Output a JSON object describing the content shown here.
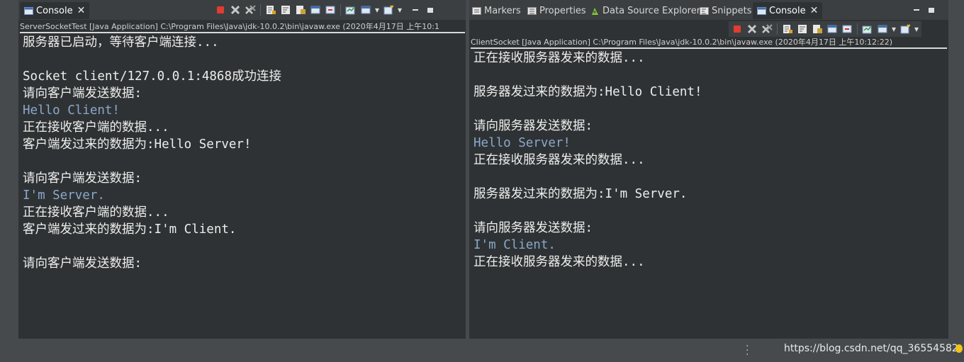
{
  "left_view": {
    "tab": {
      "label": "Console",
      "icon": "console-icon",
      "close": "✕"
    },
    "process_label": "ServerSocketTest [Java Application] C:\\Program Files\\Java\\jdk-10.0.2\\bin\\javaw.exe (2020年4月17日 上午10:1",
    "lines": [
      {
        "text": "服务器已启动，等待客户端连接...",
        "kind": "out"
      },
      {
        "text": "",
        "kind": "out"
      },
      {
        "text": "Socket client/127.0.0.1:4868成功连接",
        "kind": "out"
      },
      {
        "text": "请向客户端发送数据:",
        "kind": "out"
      },
      {
        "text": "Hello Client!",
        "kind": "input"
      },
      {
        "text": "正在接收客户端的数据...",
        "kind": "out"
      },
      {
        "text": "客户端发过来的数据为:Hello Server!",
        "kind": "out"
      },
      {
        "text": "",
        "kind": "out"
      },
      {
        "text": "请向客户端发送数据:",
        "kind": "out"
      },
      {
        "text": "I'm Server.",
        "kind": "input"
      },
      {
        "text": "正在接收客户端的数据...",
        "kind": "out"
      },
      {
        "text": "客户端发过来的数据为:I'm Client.",
        "kind": "out"
      },
      {
        "text": "",
        "kind": "out"
      },
      {
        "text": "请向客户端发送数据:",
        "kind": "out"
      }
    ]
  },
  "right_view": {
    "tabs": [
      {
        "label": "Markers",
        "icon": "markers-icon",
        "active": false
      },
      {
        "label": "Properties",
        "icon": "properties-icon",
        "active": false
      },
      {
        "label": "Data Source Explorer",
        "icon": "data-source-explorer-icon",
        "active": false
      },
      {
        "label": "Snippets",
        "icon": "snippets-icon",
        "active": false
      },
      {
        "label": "Console",
        "icon": "console-icon",
        "active": true
      }
    ],
    "close": "✕",
    "process_label": "ClientSocket [Java Application] C:\\Program Files\\Java\\jdk-10.0.2\\bin\\javaw.exe (2020年4月17日 上午10:12:22)",
    "lines": [
      {
        "text": "正在接收服务器发来的数据...",
        "kind": "out"
      },
      {
        "text": "",
        "kind": "out"
      },
      {
        "text": "服务器发过来的数据为:Hello Client!",
        "kind": "out"
      },
      {
        "text": "",
        "kind": "out"
      },
      {
        "text": "请向服务器发送数据:",
        "kind": "out"
      },
      {
        "text": "Hello Server!",
        "kind": "input"
      },
      {
        "text": "正在接收服务器发来的数据...",
        "kind": "out"
      },
      {
        "text": "",
        "kind": "out"
      },
      {
        "text": "服务器发过来的数据为:I'm Server.",
        "kind": "out"
      },
      {
        "text": "",
        "kind": "out"
      },
      {
        "text": "请向服务器发送数据:",
        "kind": "out"
      },
      {
        "text": "I'm Client.",
        "kind": "input"
      },
      {
        "text": "正在接收服务器发来的数据...",
        "kind": "out"
      }
    ]
  },
  "toolbar_icons": [
    "terminate-icon",
    "remove-launch-icon",
    "remove-all-terminated-icon",
    "scroll-lock-icon",
    "word-wrap-icon",
    "show-console-on-output-icon",
    "pin-console-icon",
    "display-selected-console-icon",
    "open-console-icon",
    "minimize-icon",
    "maximize-icon"
  ],
  "colors": {
    "background": "#2f3234",
    "text": "#ededed",
    "input_text": "#8aa8cc",
    "terminate": "#e03c31"
  },
  "watermark": "https://blog.csdn.net/qq_36554582"
}
